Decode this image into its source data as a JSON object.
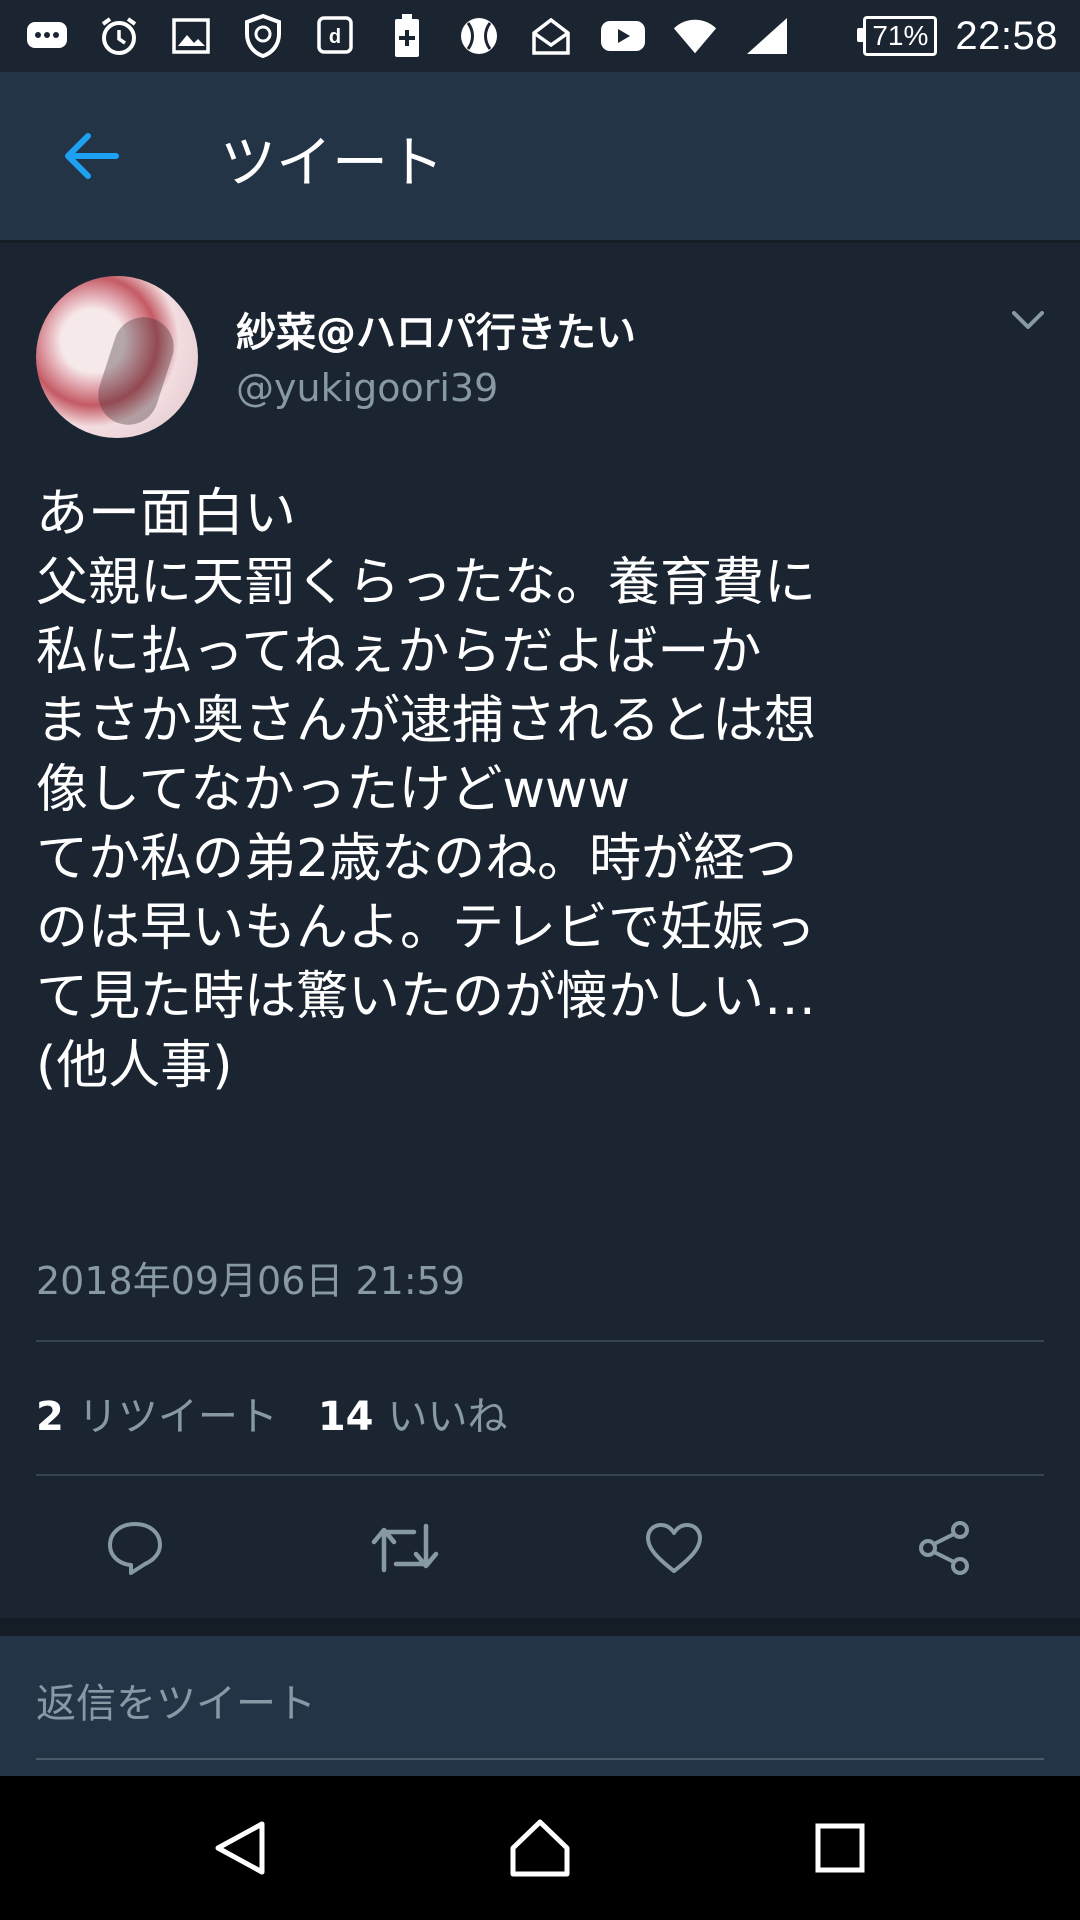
{
  "status_bar": {
    "battery": "71%",
    "time": "22:58",
    "icons": [
      "chat-bubble-icon",
      "alarm-icon",
      "image-icon",
      "shield-icon",
      "d-app-icon",
      "battery-plus-icon",
      "baseball-icon",
      "mail-icon",
      "youtube-icon",
      "wifi-icon",
      "signal-icon"
    ]
  },
  "header": {
    "title": "ツイート",
    "back_icon": "arrow-left-icon",
    "accent": "#1da1f2"
  },
  "tweet": {
    "display_name": "紗菜@ハロパ行きたい",
    "handle": "@yukigoori39",
    "lines": [
      "あー面白い",
      "父親に天罰くらったな。養育費に",
      "私に払ってねぇからだよばーか",
      "まさか奥さんが逮捕されるとは想",
      "像してなかったけどwww",
      "てか私の弟2歳なのね。時が経つ",
      "のは早いもんよ。テレビで妊娠っ",
      "て見た時は驚いたのが懐かしい…",
      "(他人事)"
    ],
    "timestamp": "2018年09月06日 21:59",
    "retweet_count": "2",
    "retweet_label": "リツイート",
    "like_count": "14",
    "like_label": "いいね"
  },
  "actions": [
    "reply-icon",
    "retweet-icon",
    "like-icon",
    "share-icon"
  ],
  "reply": {
    "placeholder": "返信をツイート"
  },
  "colors": {
    "background": "#1b2431",
    "surface": "#243447",
    "secondary_text": "#8899a6",
    "divider": "#38444d"
  }
}
